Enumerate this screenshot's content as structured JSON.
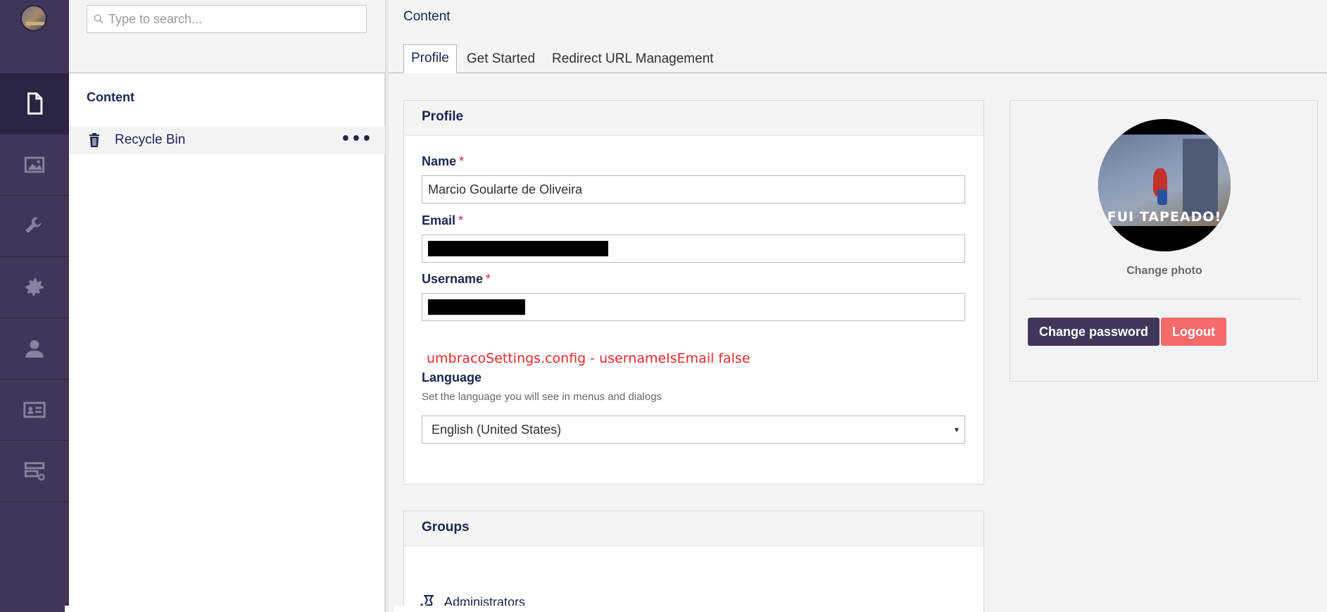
{
  "sidebar": {
    "items": [
      {
        "name": "content",
        "icon": "document-icon"
      },
      {
        "name": "media",
        "icon": "image-icon"
      },
      {
        "name": "settings",
        "icon": "wrench-icon"
      },
      {
        "name": "developer",
        "icon": "gear-icon"
      },
      {
        "name": "users",
        "icon": "user-icon"
      },
      {
        "name": "members",
        "icon": "id-card-icon"
      },
      {
        "name": "forms",
        "icon": "form-add-icon"
      }
    ],
    "active": "content"
  },
  "tree": {
    "search_placeholder": "Type to search...",
    "title": "Content",
    "recycle_bin_label": "Recycle Bin",
    "more_label": "•••"
  },
  "header": {
    "title": "Content"
  },
  "tabs": [
    {
      "label": "Profile",
      "active": true
    },
    {
      "label": "Get Started",
      "active": false
    },
    {
      "label": "Redirect URL Management",
      "active": false
    }
  ],
  "profile": {
    "heading": "Profile",
    "name_label": "Name",
    "name_value": "Marcio Goularte de Oliveira",
    "email_label": "Email",
    "username_label": "Username",
    "required_marker": "*",
    "annotation": "umbracoSettings.config - usernameIsEmail false",
    "language_label": "Language",
    "language_desc": "Set the language you will see in menus and dialogs",
    "language_value": "English (United States)",
    "caret": "▾"
  },
  "groups": {
    "heading": "Groups",
    "item": "Administrators"
  },
  "user_card": {
    "photo_caption": "FUI TAPEADO!",
    "change_photo": "Change photo",
    "change_password": "Change password",
    "logout": "Logout"
  },
  "colors": {
    "sidebar_bg": "#413659",
    "error_red": "#e22c2c",
    "logout_bg": "#f66a6a",
    "primary_btn": "#413659"
  }
}
